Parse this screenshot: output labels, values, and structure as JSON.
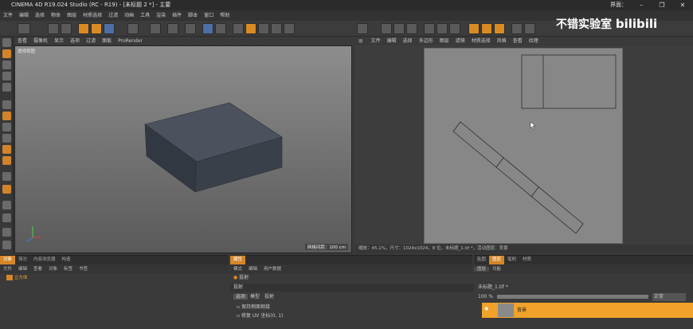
{
  "app_title": "CINEMA 4D R19.024 Studio (RC - R19) - [未标题 2 *] - 主要",
  "layout_label": "界面：",
  "menubar": [
    "文件",
    "编辑",
    "选择",
    "物体",
    "图层",
    "材质选择",
    "过滤",
    "动画",
    "工具",
    "渲染",
    "插件",
    "脚本",
    "窗口",
    "帮助"
  ],
  "window_controls": {
    "minimize": "–",
    "restore": "❐",
    "close": "✕"
  },
  "watermark": {
    "brand_cn": "不错实验室",
    "brand_logo": "bilibili"
  },
  "viewport": {
    "menu": [
      "查看",
      "摄像机",
      "显示",
      "选项",
      "过滤",
      "面板",
      "ProRender"
    ],
    "label": "透视视图",
    "grid_spacing": "网格间距：100 cm"
  },
  "uv_panel": {
    "menu": [
      "文件",
      "编辑",
      "选择",
      "多边形",
      "图层",
      "滤镜",
      "材质选择",
      "风格",
      "查看",
      "纹理"
    ],
    "status": "缩放：45.1%，尺寸：1024x1024，8 位，未标题_1.tif *，活动图层：背景"
  },
  "objects_panel": {
    "tabs": [
      "对象",
      "场次",
      "内容浏览器",
      "构造"
    ],
    "menu": [
      "文件",
      "编辑",
      "查看",
      "对象",
      "标签",
      "书签"
    ],
    "object_name": "立方体"
  },
  "attributes_panel": {
    "tabs": [
      "属性"
    ],
    "menu": [
      "模式",
      "编辑",
      "用户数据"
    ],
    "section": "投射",
    "subheader": "投射",
    "subtabs": [
      "选项",
      "模型",
      "投射"
    ],
    "items": [
      "保持侧面相接",
      "修复 UV 坐标(0, 1)"
    ]
  },
  "layers_panel": {
    "tabs": [
      "贴图",
      "图层",
      "笔刷",
      "材质"
    ],
    "subtabs": [
      "图层",
      "功能"
    ],
    "file": "未标题_1.tif *",
    "zoom": "100 %",
    "blend": "正常",
    "layer_name": "背景"
  },
  "colors": {
    "accent": "#d48628",
    "viewport_top": "#8d8d8d",
    "viewport_bottom": "#5a5a5a",
    "cube": "#3f4650"
  }
}
